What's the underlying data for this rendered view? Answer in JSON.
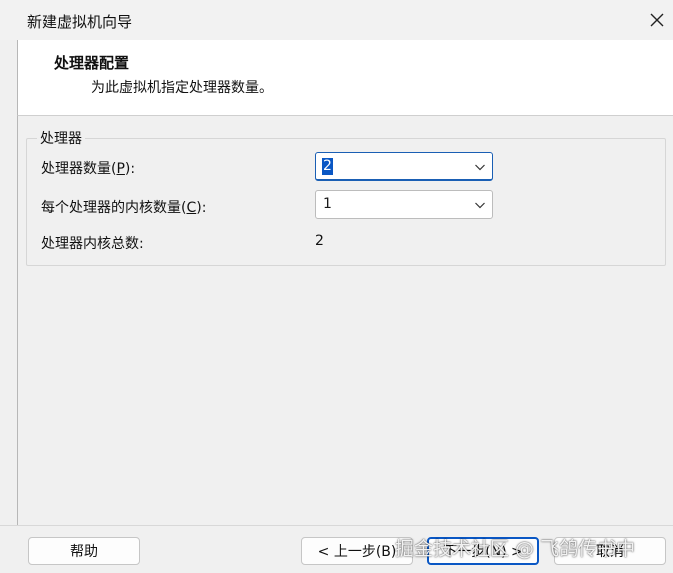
{
  "window": {
    "title": "新建虚拟机向导"
  },
  "header": {
    "title": "处理器配置",
    "subtitle": "为此虚拟机指定处理器数量。"
  },
  "group": {
    "title": "处理器",
    "processor_count": {
      "label_before": "处理器数量(",
      "accel": "P",
      "label_after": "):",
      "value": "2"
    },
    "cores_per_processor": {
      "label_before": "每个处理器的内核数量(",
      "accel": "C",
      "label_after": "):",
      "value": "1"
    },
    "total_cores": {
      "label": "处理器内核总数:",
      "value": "2"
    }
  },
  "buttons": {
    "help": "帮助",
    "back": "< 上一步(B)",
    "next": "下一步(N) >",
    "cancel": "取消"
  },
  "watermark": "掘金技术社区 @ 飞鸽传书中",
  "colors": {
    "accent": "#0a57c4",
    "header_bg": "#ffffff",
    "dialog_bg": "#f0f0f0"
  }
}
